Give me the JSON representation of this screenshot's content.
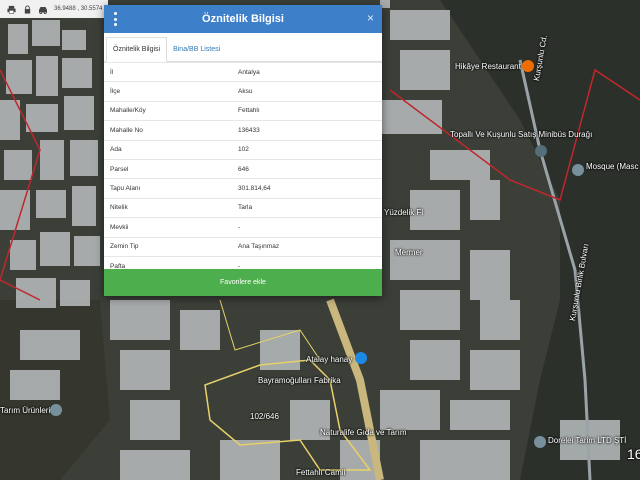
{
  "toolbar": {
    "icons": [
      "print-icon",
      "lock-icon",
      "car-icon"
    ],
    "coordinates": "36.9488 , 30.5574"
  },
  "map_labels": {
    "hikaye": "Hikâye Restaurant",
    "road1": "Kurşunlu Cd.",
    "bus": "Topallı Ve Kuşunlu Satış Minibüs Durağı",
    "mosque": "Mosque (Masc Abu Obaida",
    "atalay": "Atalay hanay",
    "bayram": "Bayramoğulları Fabrika",
    "road2": "Kurşunlu Birlik Bulvarı",
    "naturalife": "Naturalife Gıda ve Tarım",
    "fettahli": "Fettahlı Camii",
    "dorelei": "Dorelei Tarim LTD ŞTİ",
    "tarim": "Tarım Ürünleri",
    "edge_num": "16",
    "parcel_num": "102/646",
    "yuzde": "Yüzdelik Fi",
    "mermer": "Mermer"
  },
  "dialog": {
    "title": "Öznitelik Bilgisi",
    "close": "×",
    "tabs": [
      "Öznitelik Bilgisi",
      "Bina/BB Listesi"
    ],
    "rows": [
      {
        "key": "İl",
        "value": "Antalya"
      },
      {
        "key": "İlçe",
        "value": "Aksu"
      },
      {
        "key": "Mahalle/Köy",
        "value": "Fettahlı"
      },
      {
        "key": "Mahalle No",
        "value": "136433"
      },
      {
        "key": "Ada",
        "value": "102"
      },
      {
        "key": "Parsel",
        "value": "646"
      },
      {
        "key": "Tapu Alanı",
        "value": "301.814,64"
      },
      {
        "key": "Nitelik",
        "value": "Tarla"
      },
      {
        "key": "Mevkii",
        "value": "-"
      },
      {
        "key": "Zemin Tip",
        "value": "Ana Taşınmaz"
      },
      {
        "key": "Pafta",
        "value": "-"
      }
    ],
    "button": "Favorilere ekle"
  },
  "colors": {
    "header": "#3d7fc9",
    "button": "#4cae4c",
    "parcel_outline": "#e8d16a",
    "boundary": "#c0272d"
  }
}
